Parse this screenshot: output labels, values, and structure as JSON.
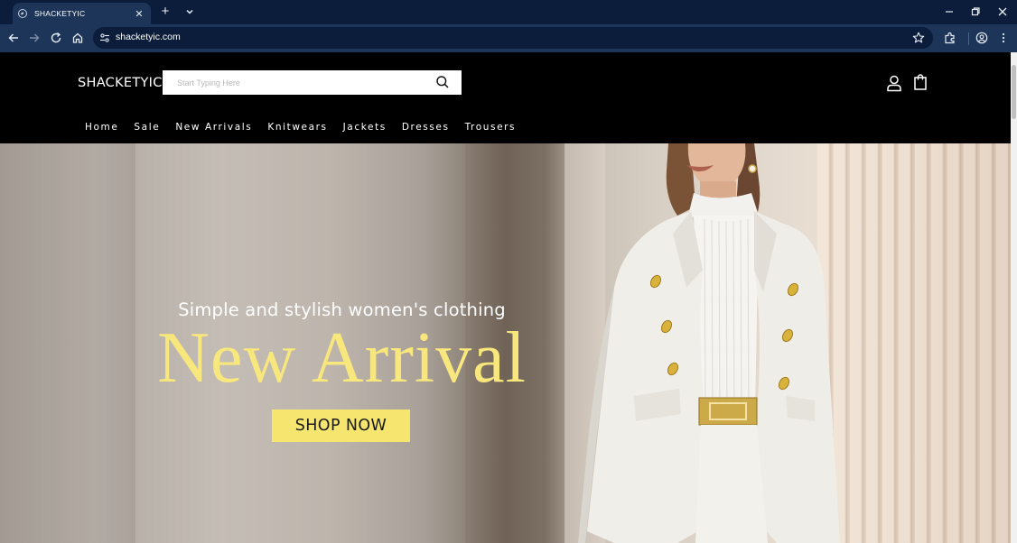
{
  "browser": {
    "tab_title": "SHACKETYIC",
    "url": "shacketyic.com"
  },
  "site": {
    "logo": "SHACKETYIC",
    "search_placeholder": "Start Typing Here",
    "nav": [
      "Home",
      "Sale",
      "New Arrivals",
      "Knitwears",
      "Jackets",
      "Dresses",
      "Trousers"
    ]
  },
  "hero": {
    "subtitle": "Simple and stylish women's clothing",
    "title": "New Arrival",
    "cta": "SHOP NOW"
  },
  "colors": {
    "browser_frame": "#0b1d3a",
    "browser_toolbar": "#1d3558",
    "header_bg": "#000000",
    "accent_yellow": "#f6e66f"
  }
}
